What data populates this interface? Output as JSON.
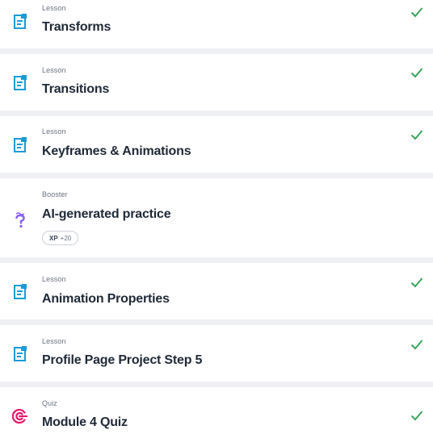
{
  "items": [
    {
      "type": "Lesson",
      "title": "Transforms",
      "completed": true,
      "icon": "lesson-doc-icon"
    },
    {
      "type": "Lesson",
      "title": "Transitions",
      "completed": true,
      "icon": "lesson-doc-icon"
    },
    {
      "type": "Lesson",
      "title": "Keyframes & Animations",
      "completed": true,
      "icon": "lesson-doc-icon"
    },
    {
      "type": "Booster",
      "title": "AI-generated practice",
      "completed": false,
      "icon": "question-mark-icon",
      "badge": {
        "label": "XP",
        "value": "+20"
      }
    },
    {
      "type": "Lesson",
      "title": "Animation Properties",
      "completed": true,
      "icon": "lesson-doc-icon"
    },
    {
      "type": "Lesson",
      "title": "Profile Page Project Step 5",
      "completed": true,
      "icon": "lesson-doc-icon"
    },
    {
      "type": "Quiz",
      "title": "Module 4 Quiz",
      "completed": true,
      "icon": "target-icon"
    }
  ],
  "colors": {
    "lesson_icon": "#1a9bd7",
    "booster_icon": "#8b5cf6",
    "quiz_icon": "#e5186d",
    "check": "#3ba55c",
    "separator": "#eef0f4"
  }
}
